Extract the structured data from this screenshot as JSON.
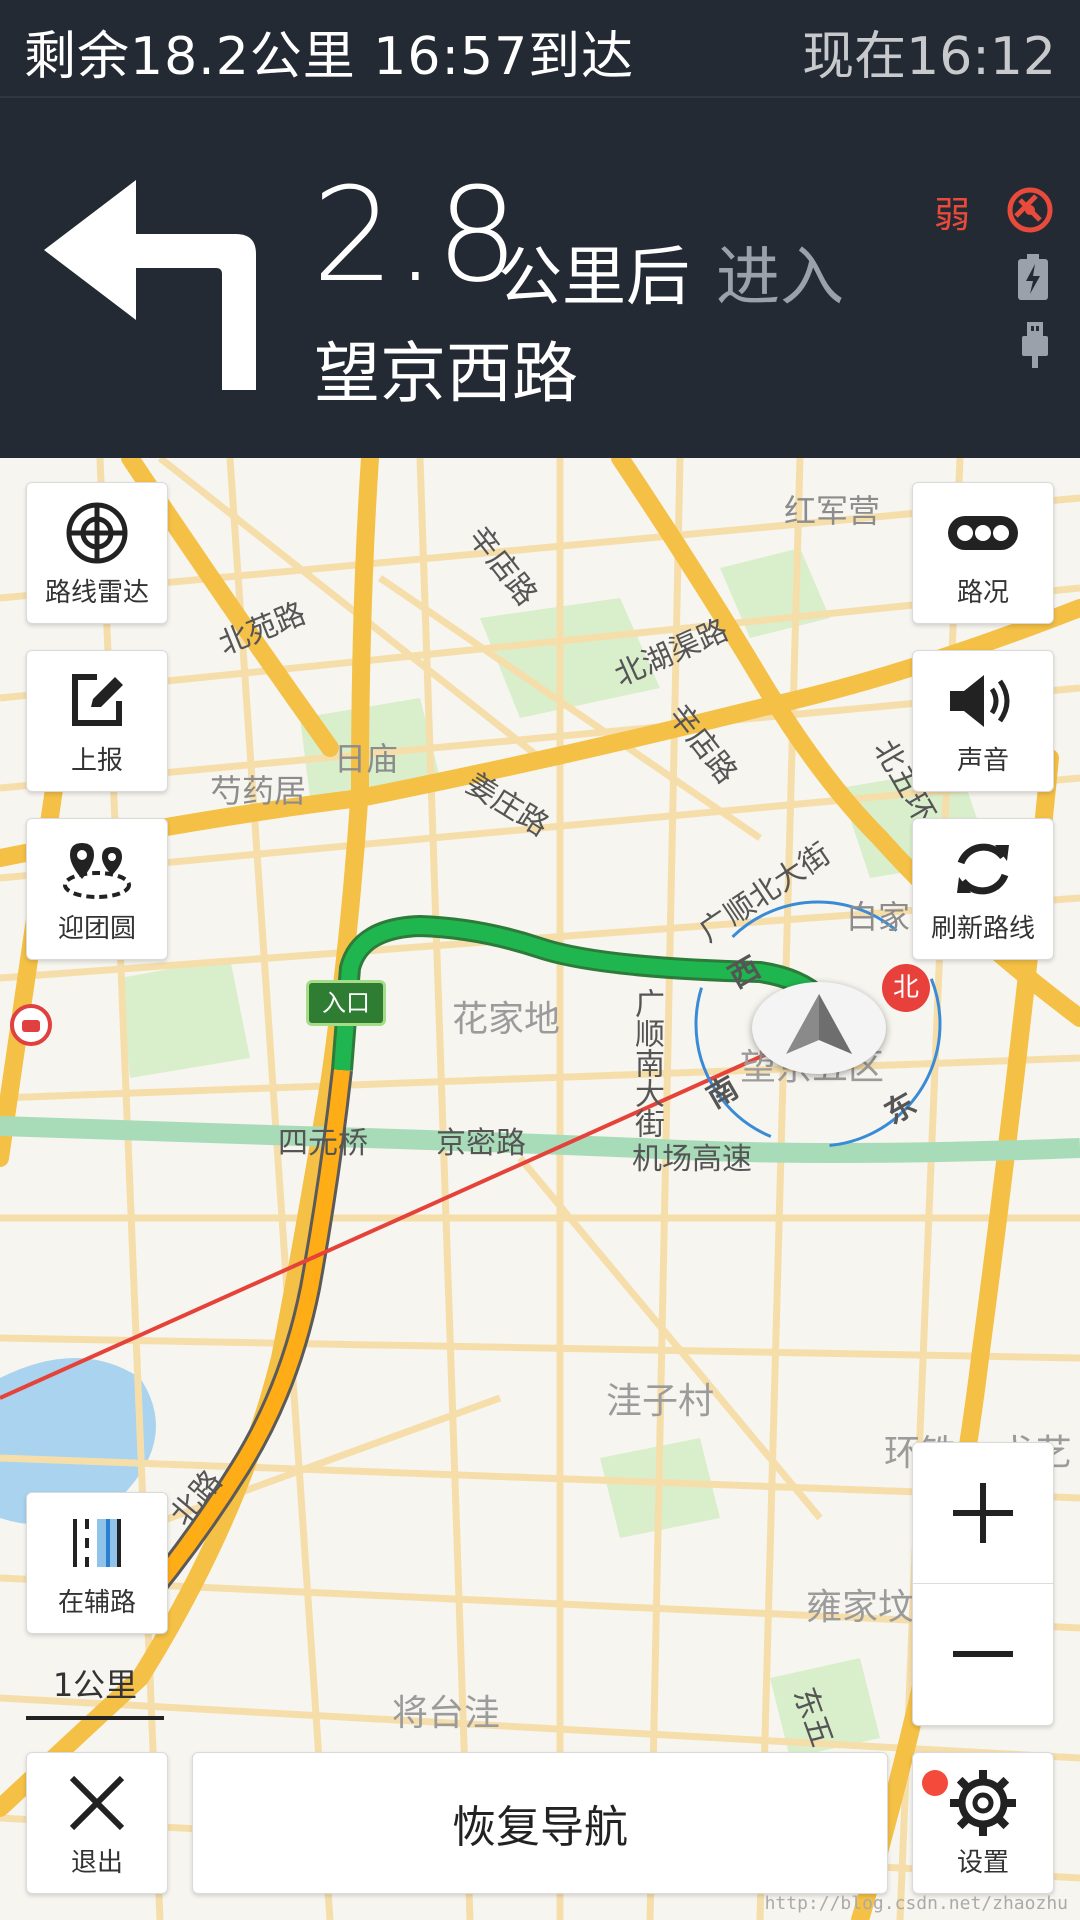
{
  "status": {
    "remaining": "剩余18.2公里  16:57到达",
    "now": "现在16:12"
  },
  "guidance": {
    "distance": "2.8",
    "unit": "公里后",
    "action": "进入",
    "road": "望京西路",
    "signal": "弱"
  },
  "map_labels": {
    "hongjunying": "红军营",
    "xindianlu1": "辛店路",
    "beiyuanlu": "北苑路",
    "beihubulu": "北湖渠路",
    "xindianlu2": "辛店路",
    "rimiao": "日庙",
    "shaoyaoju": "芍药居",
    "jiangzhuanglu": "姜庄路",
    "beiwuhuan": "北五环",
    "guangshunbeidajie": "广顺北大街",
    "baijia": "白家",
    "huajiadi": "花家地",
    "guangshunnandajie": "广顺南大街",
    "wangjingwuqu": "望京五区",
    "siyuanqiao": "四元桥",
    "jingmilu": "京密路",
    "jichanggaosu": "机场高速",
    "waziucun": "洼子村",
    "huantie": "环铁",
    "erfeng": "戈艺",
    "yongjiafen": "雍家坟",
    "jiangtaiwa": "将台洼",
    "beilu": "北路",
    "dongwu": "东五",
    "entrance": "入口",
    "compass_n": "北",
    "compass_w": "西",
    "compass_s": "南",
    "compass_e": "东"
  },
  "left_buttons": [
    {
      "label": "路线雷达",
      "icon": "radar-icon"
    },
    {
      "label": "上报",
      "icon": "report-edit-icon"
    },
    {
      "label": "迎团圆",
      "icon": "reunion-location-icon"
    }
  ],
  "right_buttons": [
    {
      "label": "路况",
      "icon": "traffic-icon"
    },
    {
      "label": "声音",
      "icon": "speaker-icon"
    },
    {
      "label": "刷新路线",
      "icon": "refresh-icon"
    }
  ],
  "aux_road": {
    "label": "在辅路",
    "icon": "aux-road-icon"
  },
  "scale": "1公里",
  "bottom": {
    "exit": "退出",
    "resume": "恢复导航",
    "settings": "设置"
  },
  "watermark": "http://blog.csdn.net/zhaozhu",
  "colors": {
    "header_bg": "#232a33",
    "route_green": "#1fb650",
    "route_orange": "#ffad17",
    "main_road": "#f4c045",
    "water": "#a9d3ee",
    "park": "#d6ecc8",
    "notice_red": "#f34a3b"
  }
}
